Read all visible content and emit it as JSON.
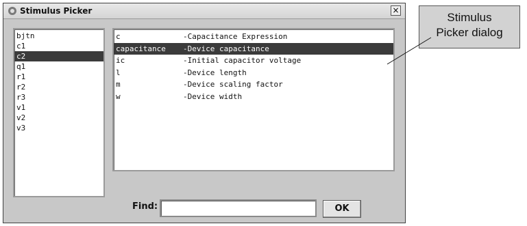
{
  "window": {
    "title": "Stimulus Picker",
    "close_glyph": "×",
    "icon": "app-icon"
  },
  "left_list": {
    "items": [
      "bjtn",
      "c1",
      "c2",
      "q1",
      "r1",
      "r2",
      "r3",
      "v1",
      "v2",
      "v3"
    ],
    "selected_index": 2
  },
  "main_list": {
    "items": [
      {
        "name": "c",
        "desc": "-Capacitance Expression"
      },
      {
        "name": "capacitance",
        "desc": "-Device capacitance"
      },
      {
        "name": "ic",
        "desc": "-Initial capacitor voltage"
      },
      {
        "name": "l",
        "desc": "-Device length"
      },
      {
        "name": "m",
        "desc": "-Device scaling factor"
      },
      {
        "name": "w",
        "desc": "-Device width"
      }
    ],
    "selected_index": 1
  },
  "find": {
    "label": "Find:",
    "value": ""
  },
  "ok_button": {
    "label": "OK"
  },
  "callout": {
    "line1": "Stimulus",
    "line2": "Picker dialog"
  },
  "colors": {
    "dialog_bg": "#c8c8c8",
    "selection_bg": "#3b3b3b",
    "callout_bg": "#d2d2d2"
  }
}
